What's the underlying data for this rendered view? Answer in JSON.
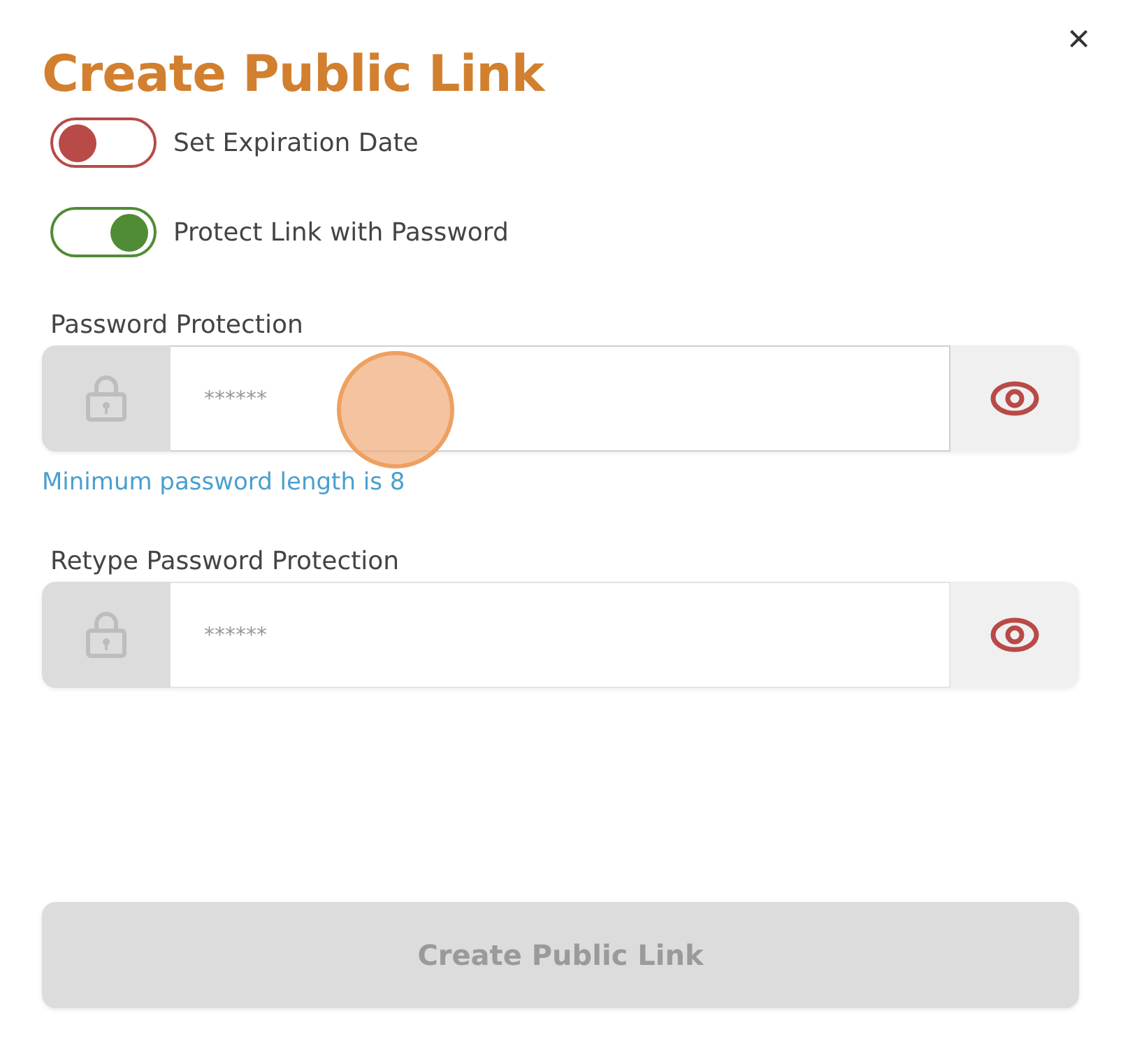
{
  "dialog": {
    "title": "Create Public Link",
    "close": "×"
  },
  "toggles": [
    {
      "label": "Set Expiration Date",
      "on": false
    },
    {
      "label": "Protect Link with Password",
      "on": true
    }
  ],
  "fields": [
    {
      "label": "Password Protection",
      "placeholder": "******",
      "focused": true,
      "hint": "Minimum password length is 8"
    },
    {
      "label": "Retype Password Protection",
      "placeholder": "******",
      "focused": false
    }
  ],
  "submit": {
    "label": "Create Public Link",
    "disabled": true
  }
}
